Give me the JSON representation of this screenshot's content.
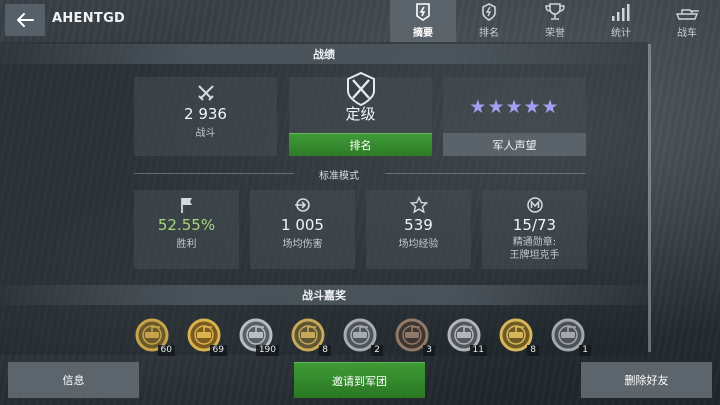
{
  "header": {
    "player_name": "AHENTGD",
    "back_icon": "arrow-left-icon"
  },
  "tabs": [
    {
      "label": "摘要",
      "icon": "summary-icon",
      "active": true
    },
    {
      "label": "排名",
      "icon": "rank-icon",
      "active": false
    },
    {
      "label": "荣誉",
      "icon": "trophy-icon",
      "active": false
    },
    {
      "label": "统计",
      "icon": "stats-icon",
      "active": false
    },
    {
      "label": "战车",
      "icon": "tank-icon",
      "active": false
    }
  ],
  "sections": {
    "record": "战绩",
    "mode": "标准模式",
    "awards": "战斗嘉奖"
  },
  "overview": {
    "battles_value": "2 936",
    "battles_label": "战斗",
    "rating_value": "定级",
    "rating_button": "排名",
    "reputation_stars": "★★★★★",
    "reputation_label": "军人声望"
  },
  "stats": [
    {
      "icon": "flag-icon",
      "value": "52.55%",
      "label": "胜利"
    },
    {
      "icon": "shell-icon",
      "value": "1 005",
      "label": "场均伤害"
    },
    {
      "icon": "star-icon",
      "value": "539",
      "label": "场均经验"
    },
    {
      "icon": "mastery-icon",
      "value": "15/73",
      "label": "精通勋章:\n王牌坦克手"
    }
  ],
  "medals": [
    {
      "name": "medal-1",
      "count": "60"
    },
    {
      "name": "medal-2",
      "count": "69"
    },
    {
      "name": "medal-3",
      "count": "190"
    },
    {
      "name": "medal-4",
      "count": "8"
    },
    {
      "name": "medal-5",
      "count": "2"
    },
    {
      "name": "medal-6",
      "count": "3"
    },
    {
      "name": "medal-7",
      "count": "11"
    },
    {
      "name": "medal-8",
      "count": "8"
    },
    {
      "name": "medal-9",
      "count": "1"
    }
  ],
  "buttons": {
    "info": "信息",
    "invite": "邀请到军团",
    "remove_friend": "删除好友"
  },
  "colors": {
    "accent_green": "#3f9a36",
    "star_purple": "#a79df2",
    "winrate_green": "#a8d67a"
  }
}
